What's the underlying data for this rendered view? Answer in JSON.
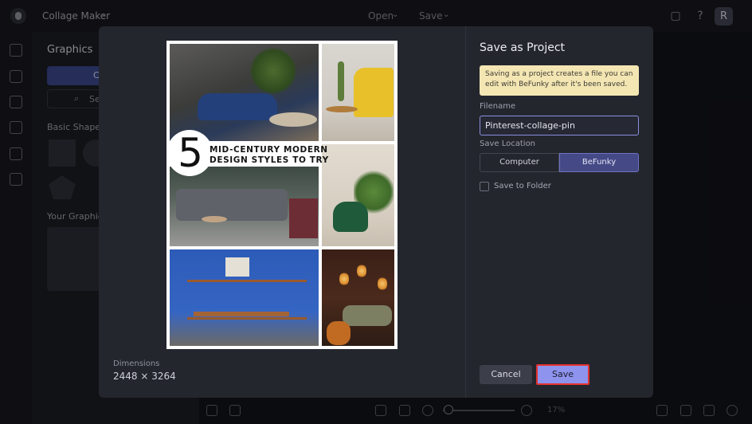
{
  "topbar": {
    "app_name": "Collage Maker",
    "menu_open": "Open",
    "menu_save": "Save",
    "avatar_initial": "R"
  },
  "sidepanel": {
    "title": "Graphics",
    "tab_label": "C",
    "search_label": "Se",
    "basic_shapes": "Basic Shapes",
    "your_graphics": "Your Graphics"
  },
  "zoom": {
    "value_text": "17%"
  },
  "preview": {
    "collage_number": "5",
    "collage_title_line1": "MID-CENTURY MODERN",
    "collage_title_line2": "DESIGN STYLES TO TRY",
    "dimensions_label": "Dimensions",
    "dimensions_value": "2448 × 3264"
  },
  "dialog": {
    "title": "Save as Project",
    "notice": "Saving as a project creates a file you can edit with BeFunky after it's been saved.",
    "filename_label": "Filename",
    "filename_value": "Pinterest-collage-pin",
    "location_label": "Save Location",
    "location_options": [
      "Computer",
      "BeFunky"
    ],
    "location_selected": "BeFunky",
    "save_to_folder_label": "Save to Folder",
    "save_to_folder_checked": false,
    "cancel_label": "Cancel",
    "save_label": "Save"
  },
  "colors": {
    "accent": "#8e93ee",
    "highlight_border": "#e2332f",
    "notice_bg": "#f3e6b3"
  }
}
